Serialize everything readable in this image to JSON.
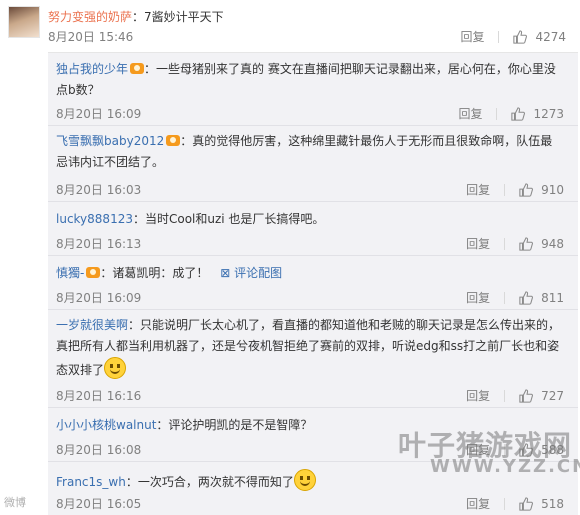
{
  "top_comment": {
    "user": "努力变强的奶萨",
    "text": "：7酱妙计平天下",
    "date": "8月20日 15:46",
    "reply_label": "回复",
    "likes": "4274"
  },
  "replies": [
    {
      "user": "独占我的少年",
      "text": "：一些母猪别来了真的 赛文在直播间把聊天记录翻出来，居心何在，你心里没点b数？",
      "date": "8月20日 16:09",
      "reply_label": "回复",
      "likes": "1273"
    },
    {
      "user": "飞雪飘飘baby2012",
      "text": "：真的觉得他厉害，这种绵里藏针最伤人于无形而且很致命啊，队伍最忌讳内讧不团结了。",
      "date": "8月20日 16:03",
      "reply_label": "回复",
      "likes": "910"
    },
    {
      "user": "lucky888123",
      "text": "：当时Cool和uzi 也是厂长搞得吧。",
      "date": "8月20日 16:13",
      "reply_label": "回复",
      "likes": "948"
    },
    {
      "user": "慎獨-",
      "text": "：诸葛凯明：成了！",
      "pic_link": "评论配图",
      "date": "8月20日 16:09",
      "reply_label": "回复",
      "likes": "811"
    },
    {
      "user": "一岁就很美啊",
      "text": "：只能说明厂长太心机了，看直播的都知道他和老贼的聊天记录是怎么传出来的，真把所有人都当利用机器了，还是兮夜机智拒绝了赛前的双排，听说edg和ss打之前厂长也和姿态双排了",
      "date": "8月20日 16:16",
      "reply_label": "回复",
      "likes": "727"
    },
    {
      "user": "小小小核桃walnut",
      "text": "：评论护明凯的是不是智障？",
      "date": "8月20日 16:08",
      "reply_label": "回复",
      "likes": "588"
    },
    {
      "user": "Franc1s_wh",
      "text": "：一次巧合，两次就不得而知了",
      "date": "8月20日 16:05",
      "reply_label": "回复",
      "likes": "518"
    }
  ],
  "watermark": {
    "brand": "叶子猪游戏网",
    "url": "WWW.YZZ.CN",
    "weibo": "微博"
  },
  "colors": {
    "accent_orange": "#eb7350",
    "link_blue": "#3a6fb0",
    "reply_bg": "#f2f2f5"
  }
}
